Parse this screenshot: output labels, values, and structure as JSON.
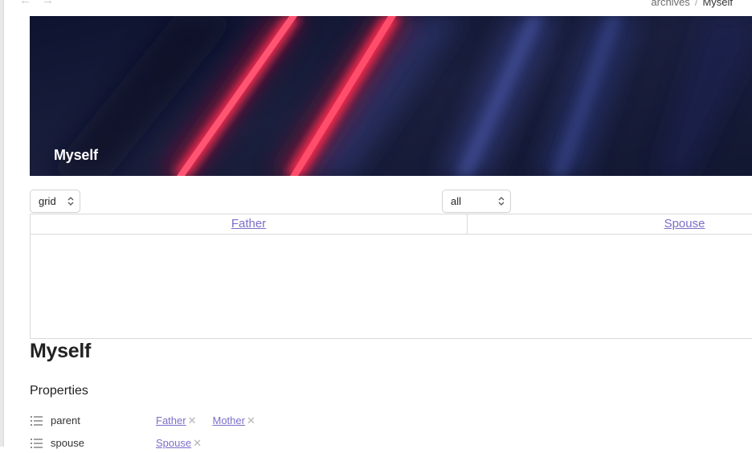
{
  "toolbar": {
    "back_icon": "arrow-left-icon",
    "forward_icon": "arrow-right-icon"
  },
  "breadcrumb": {
    "parent": "archives",
    "separator": "/",
    "current": "Myself"
  },
  "banner": {
    "title": "Myself"
  },
  "controls": {
    "view_select": "grid",
    "filter_select": "all"
  },
  "tabs": [
    {
      "label": "Father"
    },
    {
      "label": "Spouse"
    }
  ],
  "page": {
    "title": "Myself",
    "section_title": "Properties"
  },
  "properties": [
    {
      "name": "parent",
      "icon": "list-icon",
      "values": [
        "Father",
        "Mother"
      ]
    },
    {
      "name": "spouse",
      "icon": "list-icon",
      "values": [
        "Spouse"
      ]
    }
  ],
  "colors": {
    "link": "#7b6fc8",
    "banner_bg": "#131a33",
    "banner_accent": "#ff2d55"
  }
}
